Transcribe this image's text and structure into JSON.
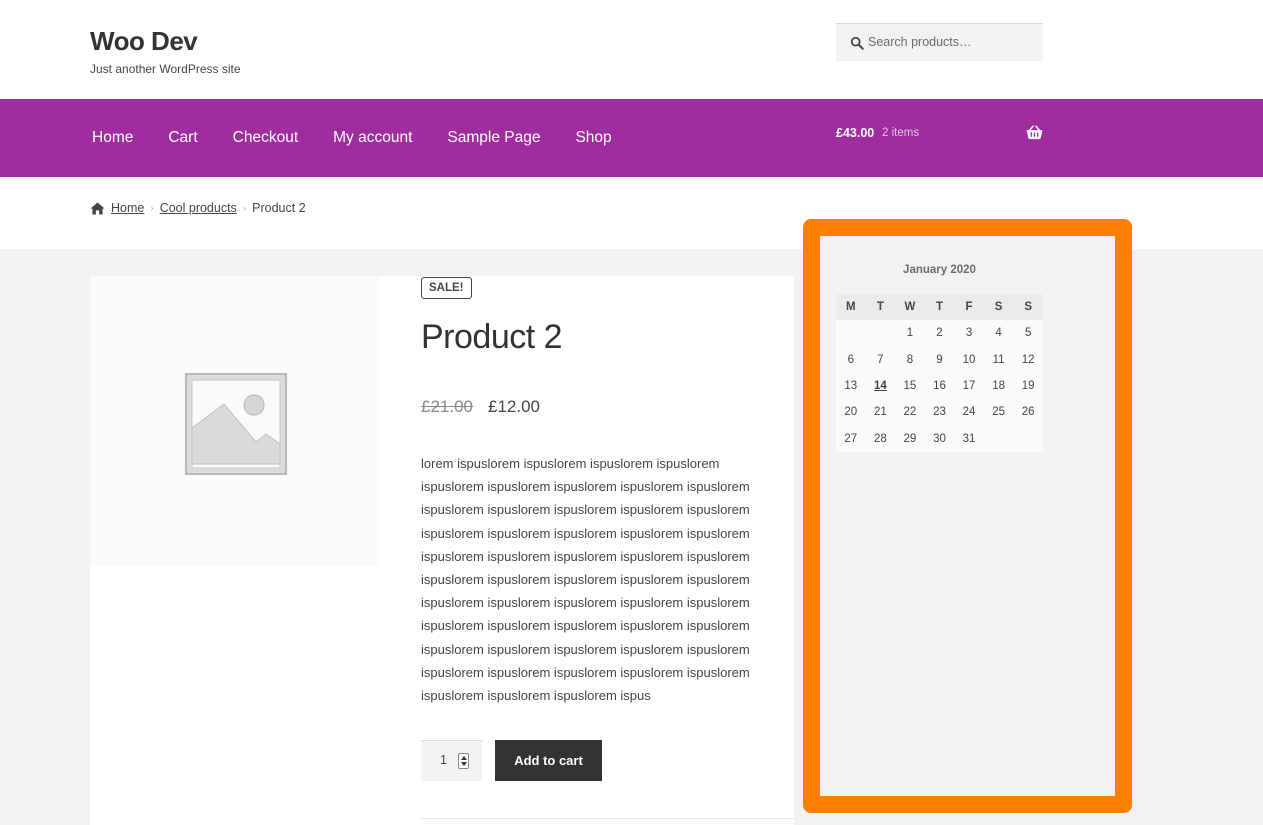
{
  "header": {
    "site_title": "Woo Dev",
    "site_description": "Just another WordPress site",
    "search": {
      "placeholder": "Search products…",
      "icon": "search-icon"
    }
  },
  "nav": {
    "items": [
      "Home",
      "Cart",
      "Checkout",
      "My account",
      "Sample Page",
      "Shop"
    ],
    "cart_amount": "£43.00",
    "cart_count": "2 items",
    "cart_icon": "basket-icon",
    "background_color": "#a02da0"
  },
  "breadcrumb": {
    "items": [
      "Home",
      "Cool products",
      "Product 2"
    ]
  },
  "product": {
    "sale_badge": "SALE!",
    "title": "Product 2",
    "price_old": "£21.00",
    "price_new": "£12.00",
    "description": "lorem ispuslorem ispuslorem ispuslorem ispuslorem ispuslorem ispuslorem ispuslorem ispuslorem ispuslorem ispuslorem ispuslorem ispuslorem ispuslorem ispuslorem ispuslorem ispuslorem ispuslorem ispuslorem ispuslorem ispuslorem ispuslorem ispuslorem ispuslorem ispuslorem ispuslorem ispuslorem ispuslorem ispuslorem ispuslorem ispuslorem ispuslorem ispuslorem ispuslorem ispuslorem ispuslorem ispuslorem ispuslorem ispuslorem ispuslorem ispuslorem ispuslorem ispuslorem ispuslorem ispuslorem ispuslorem ispuslorem ispuslorem ispuslorem ispuslorem ispuslorem ispuslorem ispuslorem ispus",
    "quantity": "1",
    "add_to_cart_label": "Add to cart"
  },
  "sidebar": {
    "highlight_color": "#ff8000",
    "calendar": {
      "caption": "January 2020",
      "weekdays": [
        "M",
        "T",
        "W",
        "T",
        "F",
        "S",
        "S"
      ],
      "weeks": [
        [
          "",
          "",
          "1",
          "2",
          "3",
          "4",
          "5"
        ],
        [
          "6",
          "7",
          "8",
          "9",
          "10",
          "11",
          "12"
        ],
        [
          "13",
          "14",
          "15",
          "16",
          "17",
          "18",
          "19"
        ],
        [
          "20",
          "21",
          "22",
          "23",
          "24",
          "25",
          "26"
        ],
        [
          "27",
          "28",
          "29",
          "30",
          "31",
          "",
          ""
        ]
      ],
      "today": "14"
    }
  }
}
